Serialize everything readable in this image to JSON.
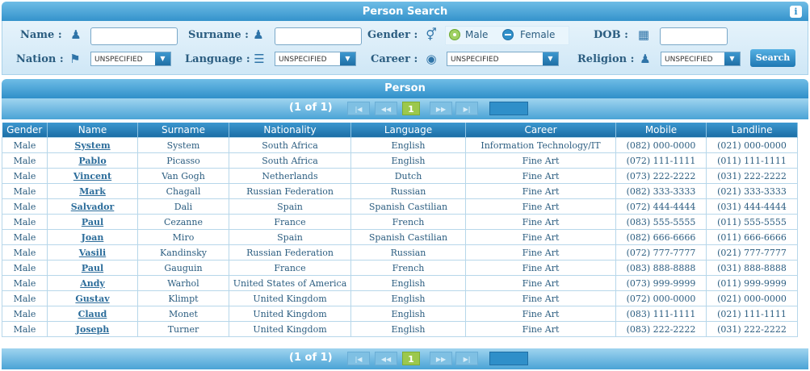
{
  "search": {
    "title": "Person Search",
    "info_icon": "info-icon",
    "name_label": "Name :",
    "surname_label": "Surname :",
    "gender_label": "Gender :",
    "dob_label": "DOB :",
    "nation_label": "Nation :",
    "language_label": "Language :",
    "career_label": "Career :",
    "religion_label": "Religion :",
    "name_value": "",
    "surname_value": "",
    "dob_value": "",
    "male_label": "Male",
    "female_label": "Female",
    "selected_gender": "Male",
    "nation_value": "UNSPECIFIED",
    "language_value": "UNSPECIFIED",
    "career_value": "UNSPECIFIED",
    "religion_value": "UNSPECIFIED",
    "search_button": "Search"
  },
  "person": {
    "title": "Person",
    "page_info": "(1 of 1)",
    "current_page": "1",
    "columns": [
      "Gender",
      "Name",
      "Surname",
      "Nationality",
      "Language",
      "Career",
      "Mobile",
      "Landline"
    ],
    "rows": [
      [
        "Male",
        "System",
        "System",
        "South Africa",
        "English",
        "Information Technology/IT",
        "(082) 000-0000",
        "(021) 000-0000"
      ],
      [
        "Male",
        "Pablo",
        "Picasso",
        "South Africa",
        "English",
        "Fine Art",
        "(072) 111-1111",
        "(011) 111-1111"
      ],
      [
        "Male",
        "Vincent",
        "Van Gogh",
        "Netherlands",
        "Dutch",
        "Fine Art",
        "(073) 222-2222",
        "(031) 222-2222"
      ],
      [
        "Male",
        "Mark",
        "Chagall",
        "Russian Federation",
        "Russian",
        "Fine Art",
        "(082) 333-3333",
        "(021) 333-3333"
      ],
      [
        "Male",
        "Salvador",
        "Dali",
        "Spain",
        "Spanish Castilian",
        "Fine Art",
        "(072) 444-4444",
        "(031) 444-4444"
      ],
      [
        "Male",
        "Paul",
        "Cezanne",
        "France",
        "French",
        "Fine Art",
        "(083) 555-5555",
        "(011) 555-5555"
      ],
      [
        "Male",
        "Joan",
        "Miro",
        "Spain",
        "Spanish Castilian",
        "Fine Art",
        "(082) 666-6666",
        "(011) 666-6666"
      ],
      [
        "Male",
        "Vasili",
        "Kandinsky",
        "Russian Federation",
        "Russian",
        "Fine Art",
        "(072) 777-7777",
        "(021) 777-7777"
      ],
      [
        "Male",
        "Paul",
        "Gauguin",
        "France",
        "French",
        "Fine Art",
        "(083) 888-8888",
        "(031) 888-8888"
      ],
      [
        "Male",
        "Andy",
        "Warhol",
        "United States of America",
        "English",
        "Fine Art",
        "(073) 999-9999",
        "(011) 999-9999"
      ],
      [
        "Male",
        "Gustav",
        "Klimpt",
        "United Kingdom",
        "English",
        "Fine Art",
        "(072) 000-0000",
        "(021) 000-0000"
      ],
      [
        "Male",
        "Claud",
        "Monet",
        "United Kingdom",
        "English",
        "Fine Art",
        "(083) 111-1111",
        "(021) 111-1111"
      ],
      [
        "Male",
        "Joseph",
        "Turner",
        "United Kingdom",
        "English",
        "Fine Art",
        "(083) 222-2222",
        "(031) 222-2222"
      ]
    ]
  }
}
